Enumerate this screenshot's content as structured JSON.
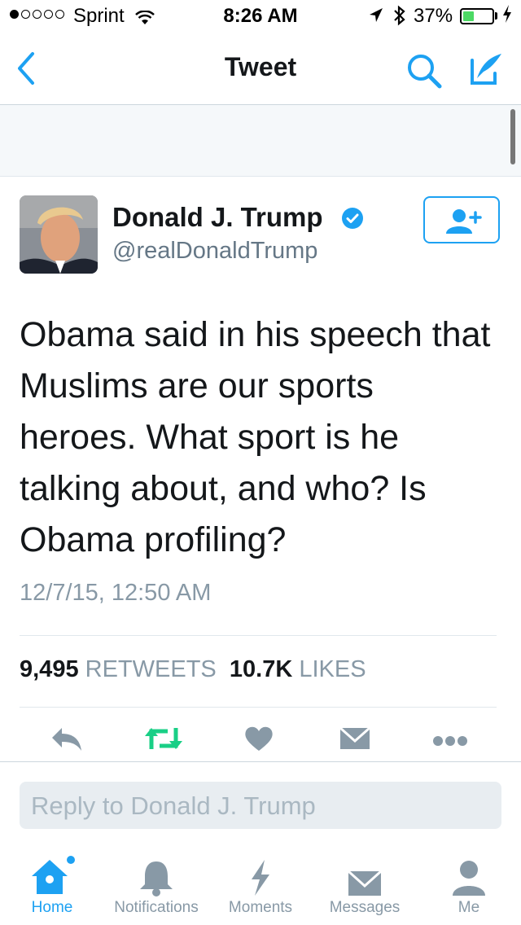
{
  "status_bar": {
    "carrier": "Sprint",
    "time": "8:26 AM",
    "battery_pct": "37%",
    "battery_level": 0.37,
    "signal_bars_filled": 1,
    "signal_bars_total": 5
  },
  "nav": {
    "title": "Tweet",
    "back_icon": "chevron-left-icon",
    "search_icon": "search-icon",
    "compose_icon": "compose-icon"
  },
  "tweet": {
    "author_name": "Donald J. Trump",
    "handle": "@realDonaldTrump",
    "verified": true,
    "text": "Obama said in his speech that Muslims are our sports heroes. What sport is he talking about, and who? Is Obama profiling?",
    "timestamp": "12/7/15, 12:50 AM",
    "retweet_count": "9,495",
    "retweet_label": "RETWEETS",
    "like_count": "10.7K",
    "like_label": "LIKES"
  },
  "reply": {
    "placeholder": "Reply to Donald J. Trump"
  },
  "tabs": [
    {
      "label": "Home",
      "icon": "home-icon",
      "active": true
    },
    {
      "label": "Notifications",
      "icon": "bell-icon",
      "active": false
    },
    {
      "label": "Moments",
      "icon": "lightning-icon",
      "active": false
    },
    {
      "label": "Messages",
      "icon": "envelope-icon",
      "active": false
    },
    {
      "label": "Me",
      "icon": "person-icon",
      "active": false
    }
  ],
  "colors": {
    "accent": "#1da1f2",
    "retweet_green": "#19cf86",
    "icon_gray": "#8899a6",
    "battery_green": "#4cd964"
  }
}
